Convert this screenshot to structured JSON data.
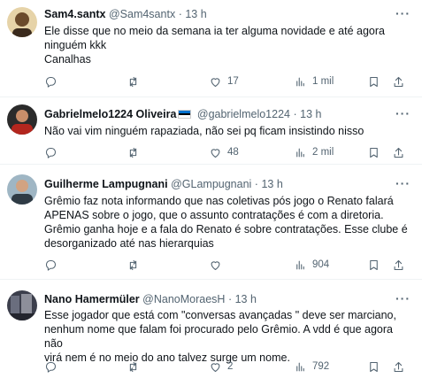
{
  "tweets": [
    {
      "name": "Sam4.santx",
      "handle": "@Sam4santx",
      "dot": "·",
      "time": "13 h",
      "text": [
        "Ele disse que no meio da semana ia ter alguma novidade e até agora",
        "ninguém kkk",
        "Canalhas"
      ],
      "replies": "",
      "retweets": "",
      "likes": "17",
      "views": "1 mil",
      "avatar_color": "#c9a86a"
    },
    {
      "name": "Gabrielmelo1224 Oliveira",
      "handle": "@gabrielmelo1224",
      "dot": "·",
      "time": "13 h",
      "text": [
        "Não vai vim ninguém rapaziada, não sei pq ficam insistindo nisso"
      ],
      "replies": "",
      "retweets": "",
      "likes": "48",
      "views": "2 mil",
      "avatar_color": "#b3261e"
    },
    {
      "name": "Guilherme Lampugnani",
      "handle": "@GLampugnani",
      "dot": "·",
      "time": "13 h",
      "text": [
        "Grêmio faz nota informando que nas coletivas pós jogo o Renato falará",
        "APENAS sobre o jogo, que o assunto contratações é com a diretoria.",
        "Grêmio ganha hoje e a fala do Renato é sobre contratações. Esse clube é",
        "desorganizado até nas hierarquias"
      ],
      "replies": "",
      "retweets": "",
      "likes": "",
      "views": "904",
      "avatar_color": "#5a6e7a"
    },
    {
      "name": "Nano Hamermüler",
      "handle": "@NanoMoraesH",
      "dot": "·",
      "time": "13 h",
      "text": [
        "Esse jogador que está com \"conversas avançadas \" deve ser marciano,",
        "nenhum nome que falam foi procurado pelo Grêmio. A vdd é que agora não",
        "virá nem é no meio do ano talvez surge um nome."
      ],
      "replies": "",
      "retweets": "",
      "likes": "2",
      "views": "792",
      "avatar_color": "#4a4a5a"
    }
  ],
  "flag_colors": [
    "#0072ce",
    "#000000",
    "#ffffff"
  ]
}
